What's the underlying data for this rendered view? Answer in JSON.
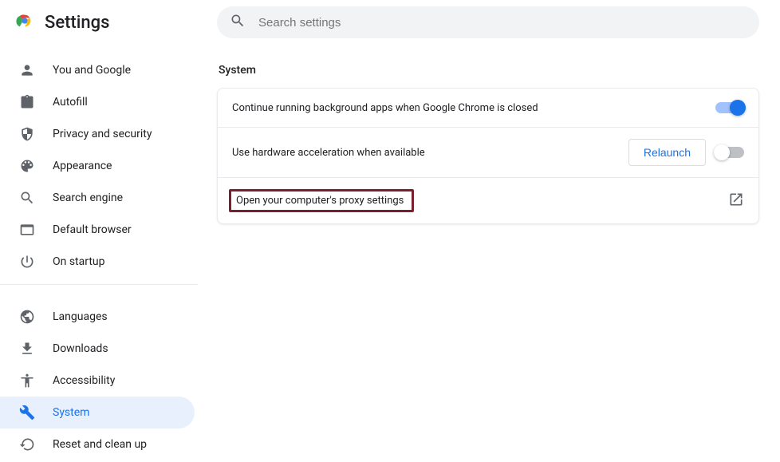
{
  "app": {
    "title": "Settings"
  },
  "search": {
    "placeholder": "Search settings"
  },
  "sidebar": {
    "primary": [
      {
        "label": "You and Google",
        "icon": "person"
      },
      {
        "label": "Autofill",
        "icon": "autofill"
      },
      {
        "label": "Privacy and security",
        "icon": "shield"
      },
      {
        "label": "Appearance",
        "icon": "palette"
      },
      {
        "label": "Search engine",
        "icon": "search"
      },
      {
        "label": "Default browser",
        "icon": "browser"
      },
      {
        "label": "On startup",
        "icon": "power"
      }
    ],
    "secondary": [
      {
        "label": "Languages",
        "icon": "globe"
      },
      {
        "label": "Downloads",
        "icon": "download"
      },
      {
        "label": "Accessibility",
        "icon": "accessibility"
      },
      {
        "label": "System",
        "icon": "wrench",
        "selected": true
      },
      {
        "label": "Reset and clean up",
        "icon": "reset"
      }
    ]
  },
  "section": {
    "title": "System",
    "rows": {
      "bg_apps": {
        "label": "Continue running background apps when Google Chrome is closed",
        "on": true
      },
      "hw_accel": {
        "label": "Use hardware acceleration when available",
        "on": false,
        "button": "Relaunch"
      },
      "proxy": {
        "label": "Open your computer's proxy settings"
      }
    }
  }
}
